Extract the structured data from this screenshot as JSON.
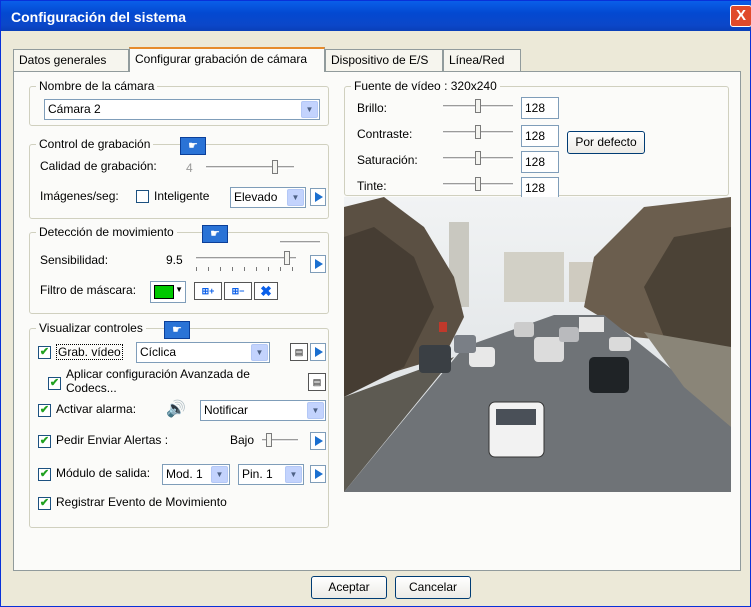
{
  "window": {
    "title": "Configuración del sistema",
    "close_label": "X"
  },
  "tabs": [
    "Datos generales",
    "Configurar grabación de cámara",
    "Dispositivo de E/S",
    "Línea/Red"
  ],
  "camera_name": {
    "label": "Nombre de la cámara",
    "value": "Cámara 2"
  },
  "recording_control": {
    "label": "Control de grabación",
    "quality_label": "Calidad de grabación:",
    "quality_value": "4",
    "fps_label": "Imágenes/seg:",
    "smart_label": "Inteligente",
    "fps_value": "Elevado"
  },
  "motion_detection": {
    "label": "Detección de movimiento",
    "sensitivity_label": "Sensibilidad:",
    "sensitivity_value": "9.5",
    "mask_label": "Filtro de máscara:"
  },
  "display_controls": {
    "label": "Visualizar controles",
    "record_video_label": "Grab. vídeo",
    "record_video_value": "Cíclica",
    "advanced_codecs_label": "Aplicar configuración Avanzada de Codecs...",
    "alarm_label": "Activar alarma:",
    "alarm_value": "Notificar",
    "alerts_label": "Pedir Enviar Alertas :",
    "alerts_level": "Bajo",
    "output_label": "Módulo de salida:",
    "module_value": "Mod. 1",
    "pin_value": "Pin. 1",
    "log_motion_label": "Registrar Evento de Movimiento"
  },
  "video_source": {
    "label": "Fuente de vídeo : 320x240",
    "brightness_label": "Brillo:",
    "brightness": "128",
    "contrast_label": "Contraste:",
    "contrast": "128",
    "saturation_label": "Saturación:",
    "saturation": "128",
    "hue_label": "Tinte:",
    "hue": "128",
    "default_button": "Por defecto"
  },
  "footer": {
    "ok": "Aceptar",
    "cancel": "Cancelar"
  },
  "colors": {
    "title_bar": "#0a5fe9",
    "accent_tab": "#e68b2c",
    "mask_color": "#00c800"
  }
}
